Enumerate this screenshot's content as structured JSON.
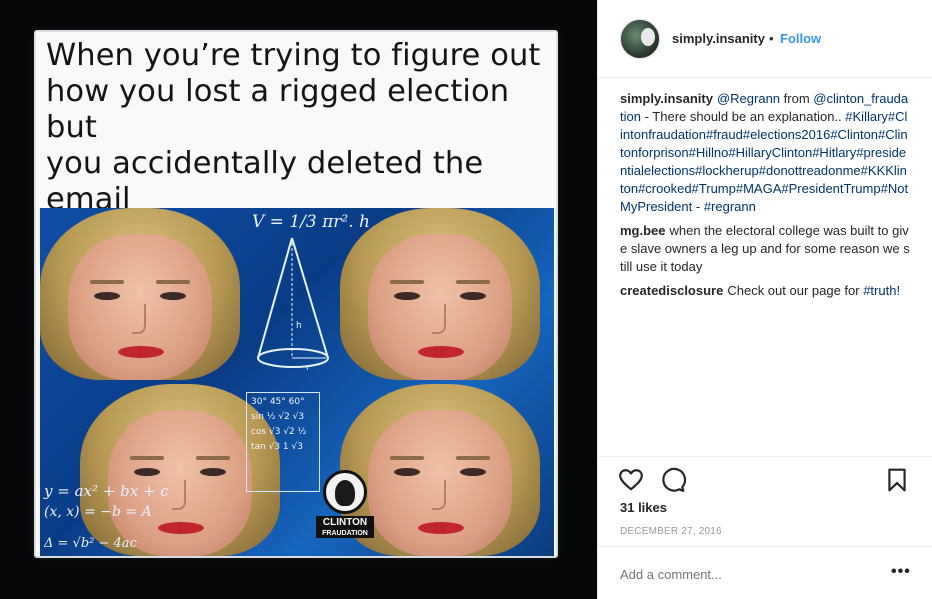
{
  "post": {
    "caption_image_text": "When you’re trying to figure out\nhow you lost a rigged election but\nyou accidentally deleted the email\nwith the full details of the plan",
    "formula_cone": "V = 1/3 πr². h",
    "formula_quadratic": "y = ax² + bx + c",
    "formula_points": "(x, x) = −b = A",
    "formula_bottom": "Δ = √b² − 4ac",
    "logo_top": "CLINTON",
    "logo_bottom": "FRAUDATION"
  },
  "header": {
    "username": "simply.insanity",
    "separator": "•",
    "follow_label": "Follow"
  },
  "comments": [
    {
      "user": "simply.insanity",
      "mention": "@Regrann",
      "text_a": " from ",
      "mention2": "@clinton_fraudation",
      "text_b": " - There should be an explanation..",
      "tags": "#Killary#Clintonfraudation#fraud#elections2016#Clinton#Clintonforprison#Hillno#HillaryClinton#Hitlary#presidentialelections#lockherup#donottreadonme#KKKlinton#crooked#Trump#MAGA#PresidentTrump#NotMyPresident",
      "text_c": " - ",
      "tag_last": "#regrann"
    },
    {
      "user": "mg.bee",
      "text": "when the electoral college was built to give slave owners a leg up and for some reason we still use it today"
    },
    {
      "user": "createdisclosure",
      "text": "Check out our page for ",
      "tag": "#truth!"
    }
  ],
  "likes": "31 likes",
  "date": "DECEMBER 27, 2016",
  "add_comment_placeholder": "Add a comment...",
  "more_label": "•••",
  "icons": {
    "like": "heart-icon",
    "comment": "comment-icon",
    "save": "bookmark-icon"
  },
  "colors": {
    "link": "#003569",
    "follow": "#3897f0",
    "muted": "#999999"
  }
}
